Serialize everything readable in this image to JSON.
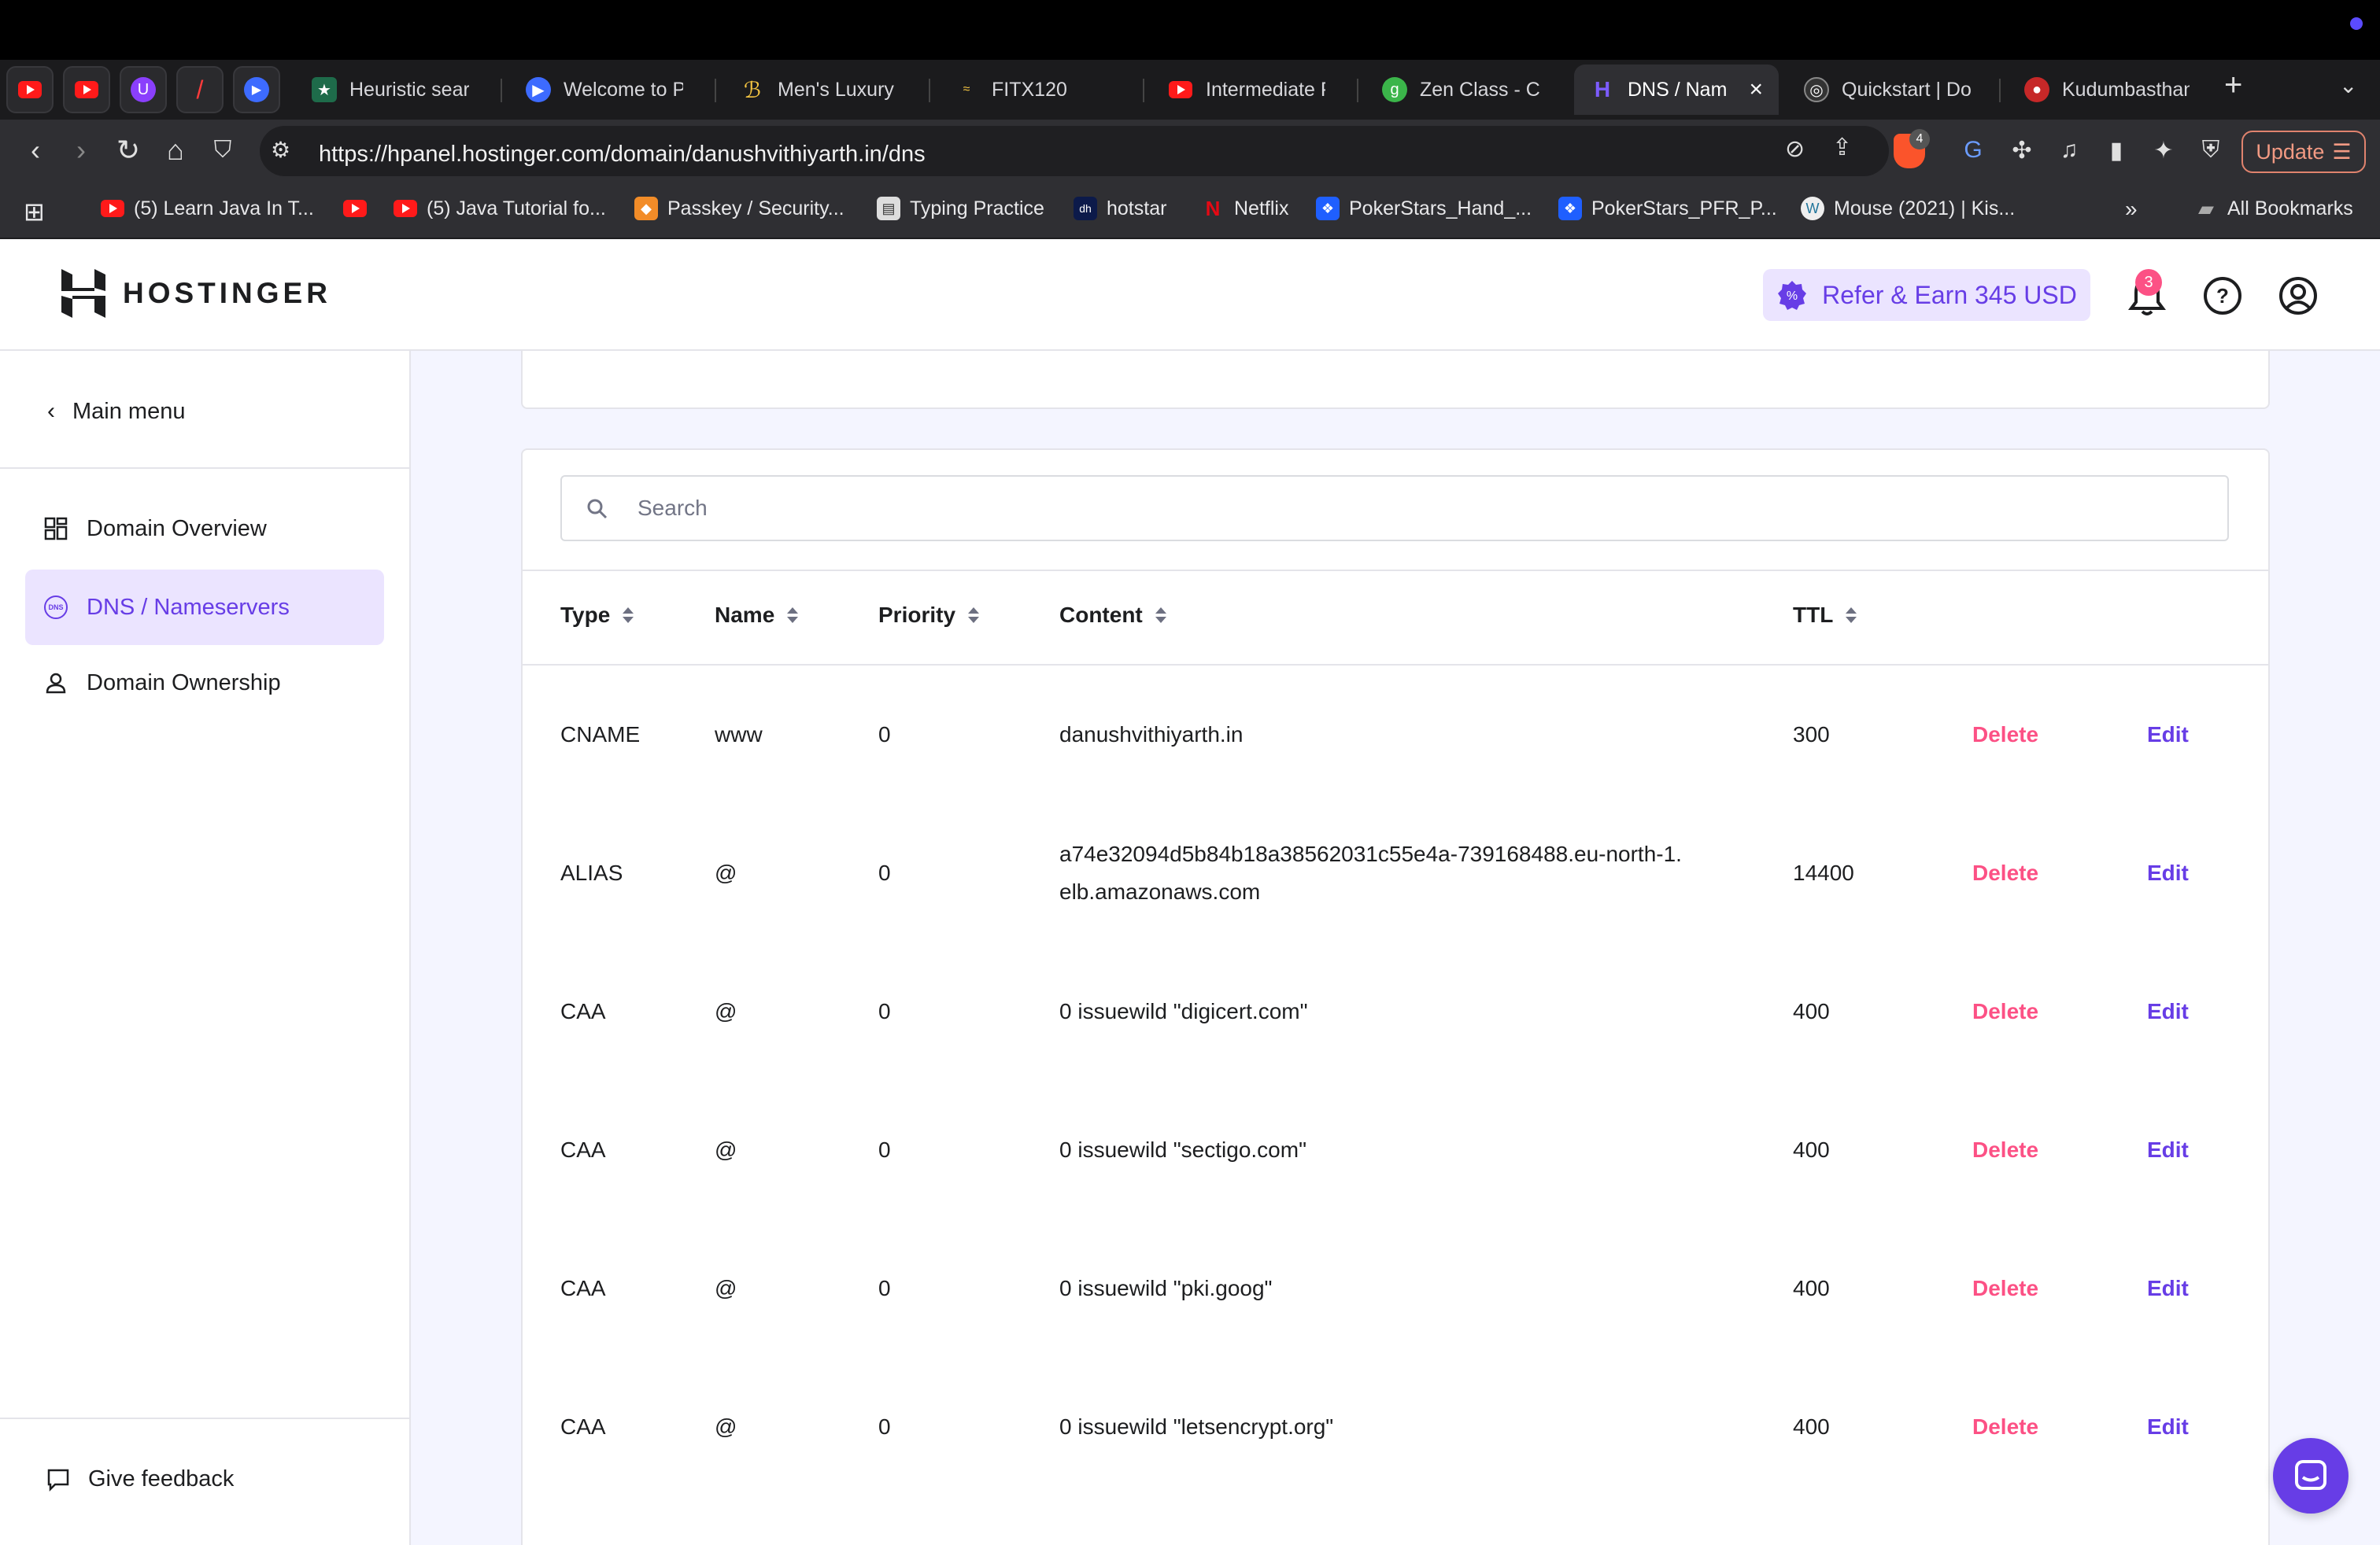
{
  "browser": {
    "tabs": [
      {
        "label": "Heuristic searc"
      },
      {
        "label": "Welcome to Pri"
      },
      {
        "label": "Men's Luxury W"
      },
      {
        "label": "FITX120"
      },
      {
        "label": "Intermediate Py"
      },
      {
        "label": "Zen Class - Ca"
      },
      {
        "label": "DNS / Nam"
      },
      {
        "label": "Quickstart | Do"
      },
      {
        "label": "Kudumbasthan"
      }
    ],
    "url": "https://hpanel.hostinger.com/domain/danushvithiyarth.in/dns",
    "brave_badge": "4",
    "update_label": "Update",
    "bookmarks": [
      {
        "label": "(5) Learn Java In T..."
      },
      {
        "label": "(5) Java Tutorial fo..."
      },
      {
        "label": "Passkey / Security..."
      },
      {
        "label": "Typing Practice"
      },
      {
        "label": "hotstar"
      },
      {
        "label": "Netflix"
      },
      {
        "label": "PokerStars_Hand_..."
      },
      {
        "label": "PokerStars_PFR_P..."
      },
      {
        "label": "Mouse (2021) | Kis..."
      }
    ],
    "all_bookmarks": "All Bookmarks"
  },
  "header": {
    "logo_text": "HOSTINGER",
    "refer_label": "Refer & Earn 345 USD",
    "notification_count": "3"
  },
  "sidebar": {
    "main_menu": "Main menu",
    "items": [
      {
        "label": "Domain Overview"
      },
      {
        "label": "DNS / Nameservers"
      },
      {
        "label": "Domain Ownership"
      }
    ],
    "feedback": "Give feedback"
  },
  "dns": {
    "search_placeholder": "Search",
    "columns": {
      "type": "Type",
      "name": "Name",
      "priority": "Priority",
      "content": "Content",
      "ttl": "TTL"
    },
    "records": [
      {
        "type": "CNAME",
        "name": "www",
        "priority": "0",
        "content": "danushvithiyarth.in",
        "content2": "",
        "ttl": "300"
      },
      {
        "type": "ALIAS",
        "name": "@",
        "priority": "0",
        "content": "a74e32094d5b84b18a38562031c55e4a-739168488.eu-north-1.",
        "content2": "elb.amazonaws.com",
        "ttl": "14400"
      },
      {
        "type": "CAA",
        "name": "@",
        "priority": "0",
        "content": "0 issuewild \"digicert.com\"",
        "content2": "",
        "ttl": "400"
      },
      {
        "type": "CAA",
        "name": "@",
        "priority": "0",
        "content": "0 issuewild \"sectigo.com\"",
        "content2": "",
        "ttl": "400"
      },
      {
        "type": "CAA",
        "name": "@",
        "priority": "0",
        "content": "0 issuewild \"pki.goog\"",
        "content2": "",
        "ttl": "400"
      },
      {
        "type": "CAA",
        "name": "@",
        "priority": "0",
        "content": "0 issuewild \"letsencrypt.org\"",
        "content2": "",
        "ttl": "400"
      }
    ],
    "delete_label": "Delete",
    "edit_label": "Edit"
  },
  "colors": {
    "brand": "#673de6",
    "delete": "#fc5185",
    "badge": "#fc5185"
  }
}
